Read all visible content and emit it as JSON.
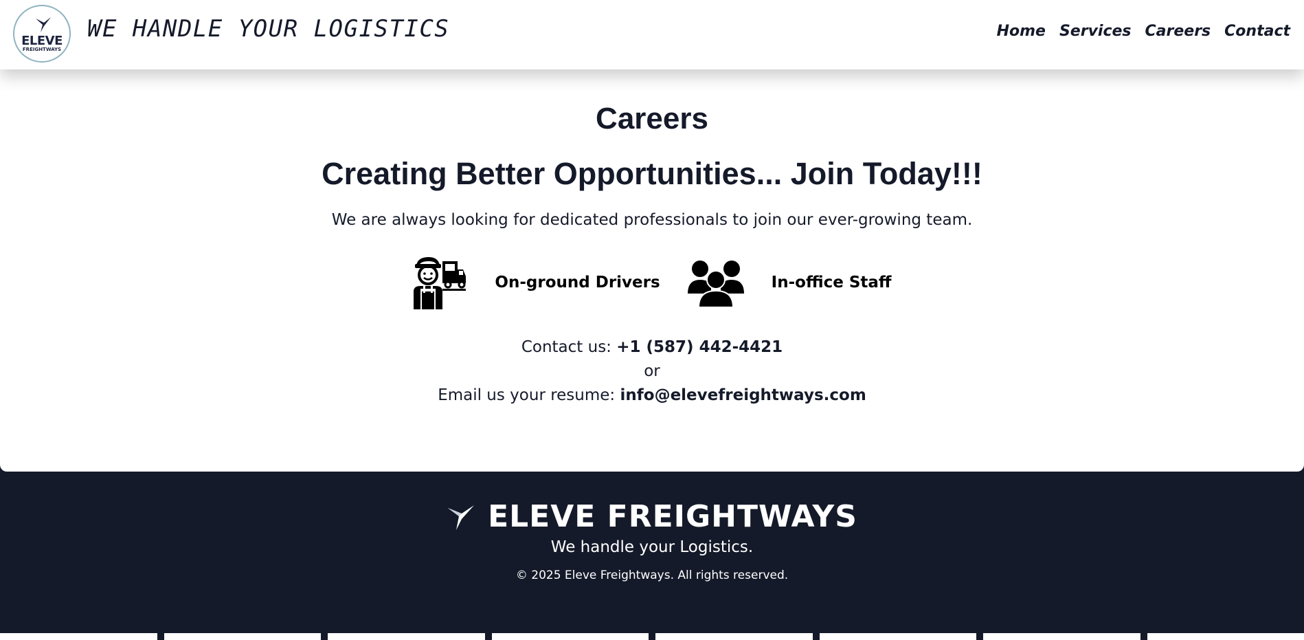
{
  "header": {
    "logo_name": "ELEVE",
    "logo_sub": "FREIGHTWAYS",
    "tagline": "WE HANDLE YOUR LOGISTICS",
    "nav": [
      "Home",
      "Services",
      "Careers",
      "Contact"
    ]
  },
  "main": {
    "title": "Careers",
    "headline": "Creating Better Opportunities... Join Today!!!",
    "intro": "We are always looking for dedicated professionals to join our ever-growing team.",
    "roles": [
      {
        "label": "On-ground Drivers",
        "icon": "truck-driver-icon"
      },
      {
        "label": "In-office Staff",
        "icon": "users-group-icon"
      }
    ],
    "contact": {
      "phone_prefix": "Contact us: ",
      "phone": "+1 (587) 442-4421",
      "or": "or",
      "email_prefix": "Email us your resume: ",
      "email": "info@elevefreightways.com"
    }
  },
  "footer": {
    "brand": "ELEVE FREIGHTWAYS",
    "tagline": "We handle your Logistics.",
    "copyright": "© 2025 Eleve Freightways. All rights reserved."
  },
  "colors": {
    "navy": "#151a2a",
    "white": "#ffffff",
    "logo_ring": "#8fb3c0"
  }
}
